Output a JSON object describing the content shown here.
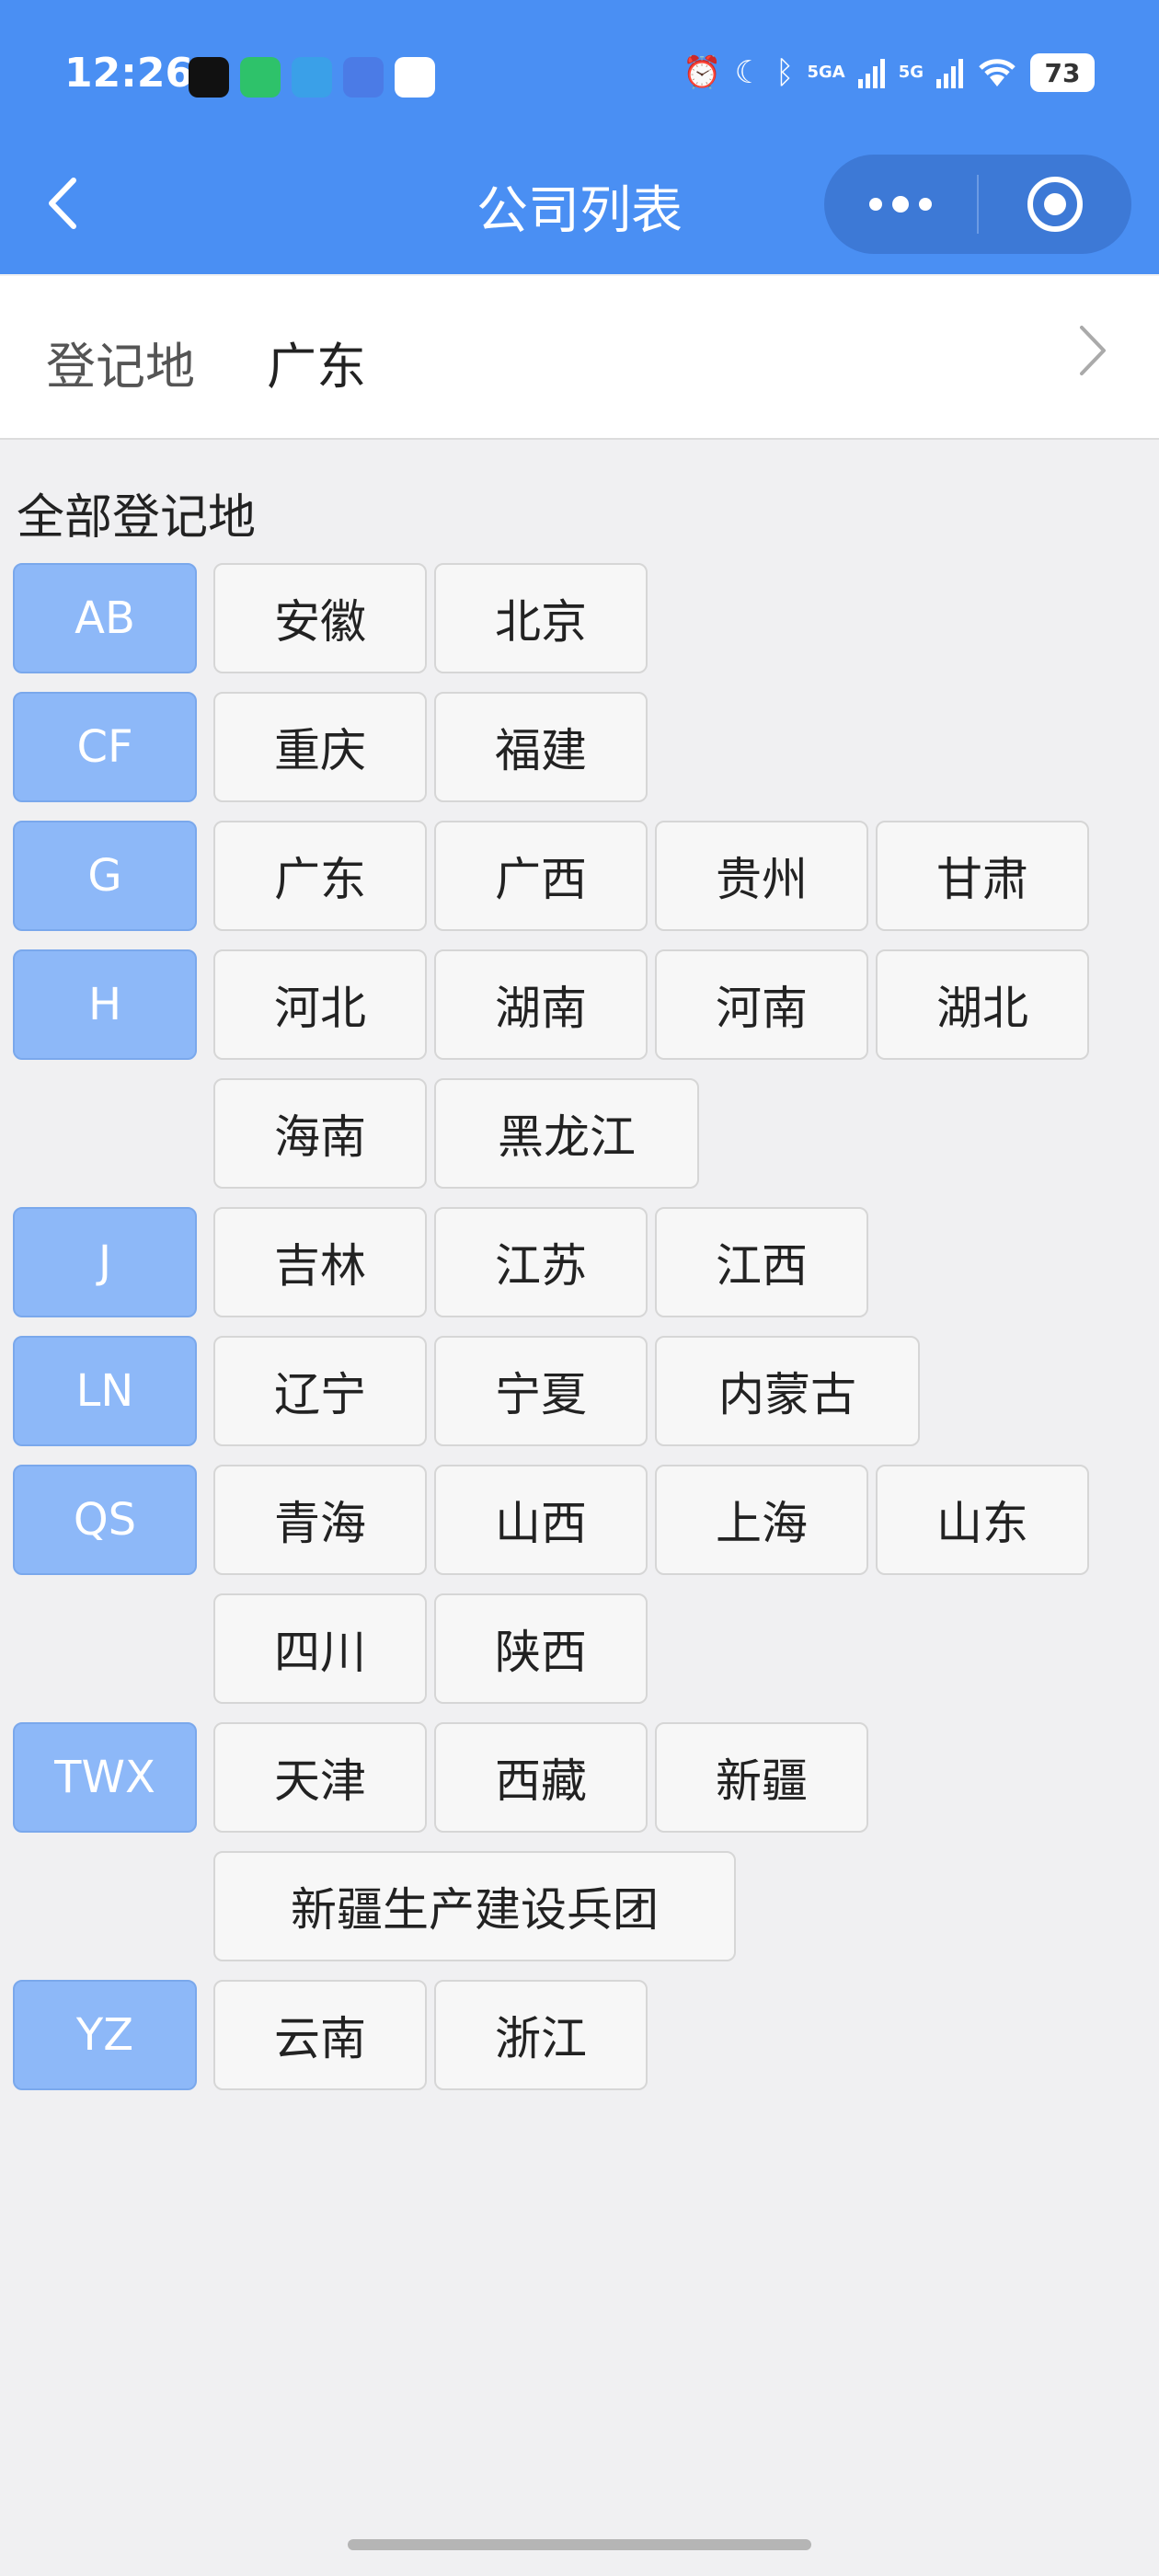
{
  "status_bar": {
    "time": "12:26",
    "net1": "5GA",
    "net2": "5G",
    "battery": "73"
  },
  "nav": {
    "title": "公司列表"
  },
  "selected": {
    "label": "登记地",
    "value": "广东"
  },
  "section_title": "全部登记地",
  "groups": [
    {
      "letter": "AB",
      "rows": [
        [
          "安徽",
          "北京"
        ]
      ]
    },
    {
      "letter": "CF",
      "rows": [
        [
          "重庆",
          "福建"
        ]
      ]
    },
    {
      "letter": "G",
      "rows": [
        [
          "广东",
          "广西",
          "贵州",
          "甘肃"
        ]
      ]
    },
    {
      "letter": "H",
      "rows": [
        [
          "河北",
          "湖南",
          "河南",
          "湖北"
        ],
        [
          "海南",
          "黑龙江"
        ]
      ]
    },
    {
      "letter": "J",
      "rows": [
        [
          "吉林",
          "江苏",
          "江西"
        ]
      ]
    },
    {
      "letter": "LN",
      "rows": [
        [
          "辽宁",
          "宁夏",
          "内蒙古"
        ]
      ]
    },
    {
      "letter": "QS",
      "rows": [
        [
          "青海",
          "山西",
          "上海",
          "山东"
        ],
        [
          "四川",
          "陕西"
        ]
      ]
    },
    {
      "letter": "TWX",
      "rows": [
        [
          "天津",
          "西藏",
          "新疆"
        ],
        [
          "新疆生产建设兵团"
        ]
      ]
    },
    {
      "letter": "YZ",
      "rows": [
        [
          "云南",
          "浙江"
        ]
      ]
    }
  ],
  "colors": {
    "header": "#4a8ff3",
    "letter_badge": "#8db8f8",
    "chip_bg": "#f7f7f7"
  }
}
